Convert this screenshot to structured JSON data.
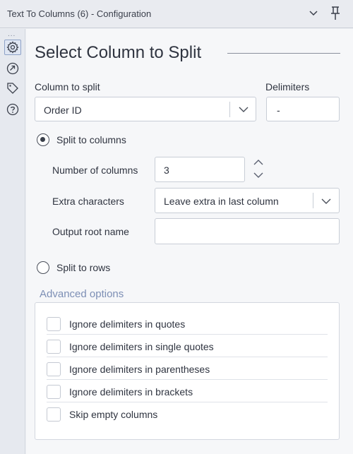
{
  "window": {
    "title": "Text To Columns (6) - Configuration"
  },
  "sidebar": {
    "overflow": "...",
    "icons": [
      "gear-icon",
      "connection-icon",
      "tag-icon",
      "help-icon"
    ]
  },
  "main": {
    "heading": "Select Column to Split",
    "column_to_split": {
      "label": "Column to split",
      "value": "Order ID"
    },
    "delimiters": {
      "label": "Delimiters",
      "value": "-"
    },
    "split_to_columns": {
      "label": "Split to columns",
      "selected": true,
      "number_of_columns": {
        "label": "Number of columns",
        "value": "3"
      },
      "extra_characters": {
        "label": "Extra characters",
        "value": "Leave extra in last column"
      },
      "output_root_name": {
        "label": "Output root name",
        "value": ""
      }
    },
    "split_to_rows": {
      "label": "Split to rows",
      "selected": false
    },
    "advanced": {
      "title": "Advanced options",
      "options": [
        {
          "label": "Ignore delimiters in quotes",
          "checked": false
        },
        {
          "label": "Ignore delimiters in single quotes",
          "checked": false
        },
        {
          "label": "Ignore delimiters in parentheses",
          "checked": false
        },
        {
          "label": "Ignore delimiters in brackets",
          "checked": false
        },
        {
          "label": "Skip empty columns",
          "checked": false
        }
      ]
    }
  },
  "colors": {
    "accent": "#7d8fb5",
    "text": "#2f3440",
    "border": "#c8cdd6"
  }
}
